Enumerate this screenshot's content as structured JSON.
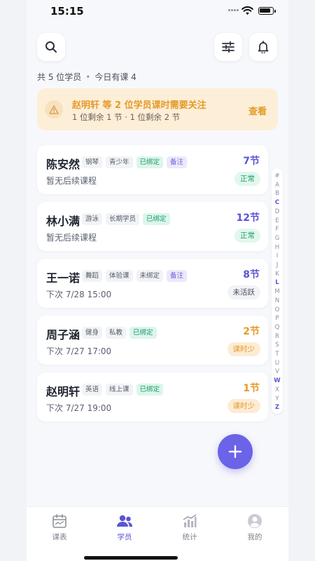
{
  "status_bar": {
    "time": "15:15"
  },
  "header": {
    "search": "search-icon",
    "filter": "filter-icon",
    "bell": "bell-icon"
  },
  "summary": {
    "students": "共 5 位学员",
    "today": "今日有课 4"
  },
  "alert": {
    "title": "赵明轩 等 2 位学员课时需要关注",
    "subtitle": "1 位剩余 1 节 · 1 位剩余 2 节",
    "action": "查看"
  },
  "students": [
    {
      "name": "陈安然",
      "tags": [
        {
          "text": "钢琴",
          "style": "gray"
        },
        {
          "text": "青少年",
          "style": "gray"
        },
        {
          "text": "已绑定",
          "style": "green"
        },
        {
          "text": "备注",
          "style": "purple"
        }
      ],
      "detail": "暂无后续课程",
      "lessons": "7节",
      "lessons_color": "#5a54d6",
      "status": "正常",
      "status_style": "green"
    },
    {
      "name": "林小满",
      "tags": [
        {
          "text": "游泳",
          "style": "gray"
        },
        {
          "text": "长期学员",
          "style": "gray"
        },
        {
          "text": "已绑定",
          "style": "green"
        }
      ],
      "detail": "暂无后续课程",
      "lessons": "12节",
      "lessons_color": "#5a54d6",
      "status": "正常",
      "status_style": "green"
    },
    {
      "name": "王一诺",
      "tags": [
        {
          "text": "舞蹈",
          "style": "gray"
        },
        {
          "text": "体验课",
          "style": "gray"
        },
        {
          "text": "未绑定",
          "style": "gray"
        },
        {
          "text": "备注",
          "style": "purple"
        }
      ],
      "detail": "下次 7/28 15:00",
      "lessons": "8节",
      "lessons_color": "#5a54d6",
      "status": "未活跃",
      "status_style": "gray"
    },
    {
      "name": "周子涵",
      "tags": [
        {
          "text": "健身",
          "style": "gray"
        },
        {
          "text": "私教",
          "style": "gray"
        },
        {
          "text": "已绑定",
          "style": "green"
        }
      ],
      "detail": "下次 7/27 17:00",
      "lessons": "2节",
      "lessons_color": "#e49b2a",
      "status": "课时少",
      "status_style": "orange"
    },
    {
      "name": "赵明轩",
      "tags": [
        {
          "text": "英语",
          "style": "gray"
        },
        {
          "text": "线上课",
          "style": "gray"
        },
        {
          "text": "已绑定",
          "style": "green"
        }
      ],
      "detail": "下次 7/27 19:00",
      "lessons": "1节",
      "lessons_color": "#e49b2a",
      "status": "课时少",
      "status_style": "orange"
    }
  ],
  "alphabet": [
    "#",
    "A",
    "B",
    "C",
    "D",
    "E",
    "F",
    "G",
    "H",
    "I",
    "J",
    "K",
    "L",
    "M",
    "N",
    "O",
    "P",
    "Q",
    "R",
    "S",
    "T",
    "U",
    "V",
    "W",
    "X",
    "Y",
    "Z"
  ],
  "alphabet_highlight": [
    "C",
    "L",
    "W",
    "Z"
  ],
  "fab": {
    "icon": "plus-icon"
  },
  "tabs": [
    {
      "label": "课表",
      "icon": "calendar-icon",
      "active": false
    },
    {
      "label": "学员",
      "icon": "people-icon",
      "active": true
    },
    {
      "label": "统计",
      "icon": "chart-icon",
      "active": false
    },
    {
      "label": "我的",
      "icon": "profile-icon",
      "active": false
    }
  ],
  "colors": {
    "accent": "#5a54d6",
    "warning": "#e49b2a",
    "success": "#25a06d"
  }
}
